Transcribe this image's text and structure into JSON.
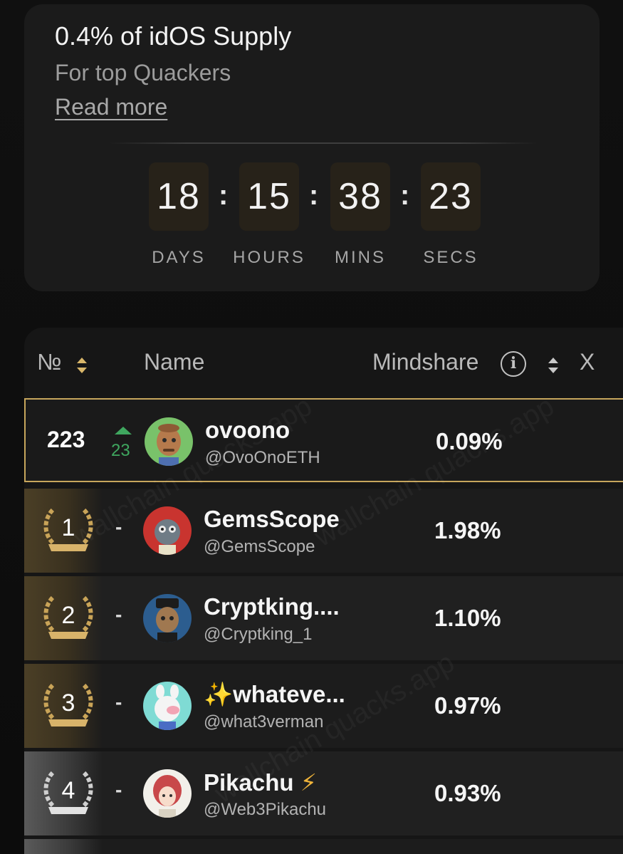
{
  "promo": {
    "title": "0.4% of idOS Supply",
    "subtitle": "For top Quackers",
    "link": "Read more",
    "countdown": {
      "days": "18",
      "hours": "15",
      "mins": "38",
      "secs": "23",
      "separator": ":",
      "labels": {
        "days": "DAYS",
        "hours": "HOURS",
        "mins": "MINS",
        "secs": "SECS"
      }
    }
  },
  "table": {
    "headers": {
      "rank": "№",
      "name": "Name",
      "mindshare": "Mindshare",
      "extra": "X"
    },
    "info_symbol": "i",
    "current_user": {
      "rank": "223",
      "delta": "23",
      "name": "ovoono",
      "handle": "@OvoOnoETH",
      "mindshare": "0.09%"
    },
    "rows": [
      {
        "rank": "1",
        "delta": "-",
        "name": "GemsScope",
        "handle": "@GemsScope",
        "mindshare": "1.98%",
        "medal": "gold"
      },
      {
        "rank": "2",
        "delta": "-",
        "name": "Cryptking....",
        "handle": "@Cryptking_1",
        "mindshare": "1.10%",
        "medal": "gold"
      },
      {
        "rank": "3",
        "delta": "-",
        "name": "✨whateve...",
        "handle": "@what3verman",
        "mindshare": "0.97%",
        "medal": "gold"
      },
      {
        "rank": "4",
        "delta": "-",
        "name": "Pikachu",
        "name_suffix": "⚡",
        "handle": "@Web3Pikachu",
        "mindshare": "0.93%",
        "medal": "silver"
      }
    ]
  },
  "watermark": "wallchain quacks.app",
  "colors": {
    "accent_gold": "#c7a65c",
    "positive_green": "#3fa75f",
    "card_bg": "#1b1b1b",
    "countdown_box": "#272219"
  }
}
